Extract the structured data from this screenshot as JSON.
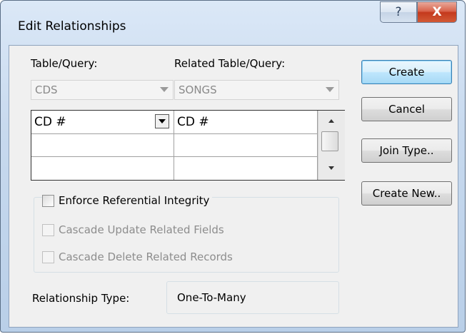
{
  "window": {
    "title": "Edit Relationships",
    "help_glyph": "?",
    "close_glyph": "X"
  },
  "labels": {
    "table_query": "Table/Query:",
    "related_table_query": "Related Table/Query:"
  },
  "combos": {
    "table": "CDS",
    "related_table": "SONGS"
  },
  "grid": {
    "rows": [
      {
        "left": "CD #",
        "right": "CD #"
      },
      {
        "left": "",
        "right": ""
      },
      {
        "left": "",
        "right": ""
      }
    ]
  },
  "buttons": {
    "create": "Create",
    "cancel": "Cancel",
    "join_type": "Join Type..",
    "create_new": "Create New.."
  },
  "options": {
    "enforce": "Enforce Referential Integrity",
    "cascade_update": "Cascade Update Related Fields",
    "cascade_delete": "Cascade Delete Related Records"
  },
  "relationship": {
    "label": "Relationship Type:",
    "value": "One-To-Many"
  }
}
